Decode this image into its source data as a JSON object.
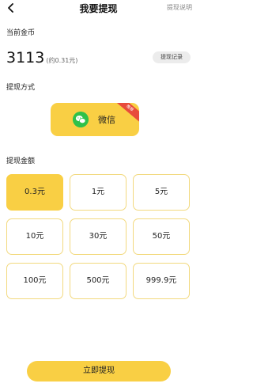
{
  "header": {
    "title": "我要提现",
    "help_label": "提现说明"
  },
  "balance": {
    "section_label": "当前金币",
    "coins": "3113",
    "approx": "(约0.31元)",
    "record_label": "提现记录"
  },
  "method": {
    "section_label": "提现方式",
    "name": "微信",
    "badge": "推荐"
  },
  "amount": {
    "section_label": "提现金额",
    "options": [
      "0.3元",
      "1元",
      "5元",
      "10元",
      "30元",
      "50元",
      "100元",
      "500元",
      "999.9元"
    ],
    "selected": "0.3元"
  },
  "submit_label": "立即提现",
  "colors": {
    "accent": "#f9cf44",
    "wechat": "#2fc14a",
    "badge": "#e84b3c",
    "option_border": "#f2d97e"
  }
}
